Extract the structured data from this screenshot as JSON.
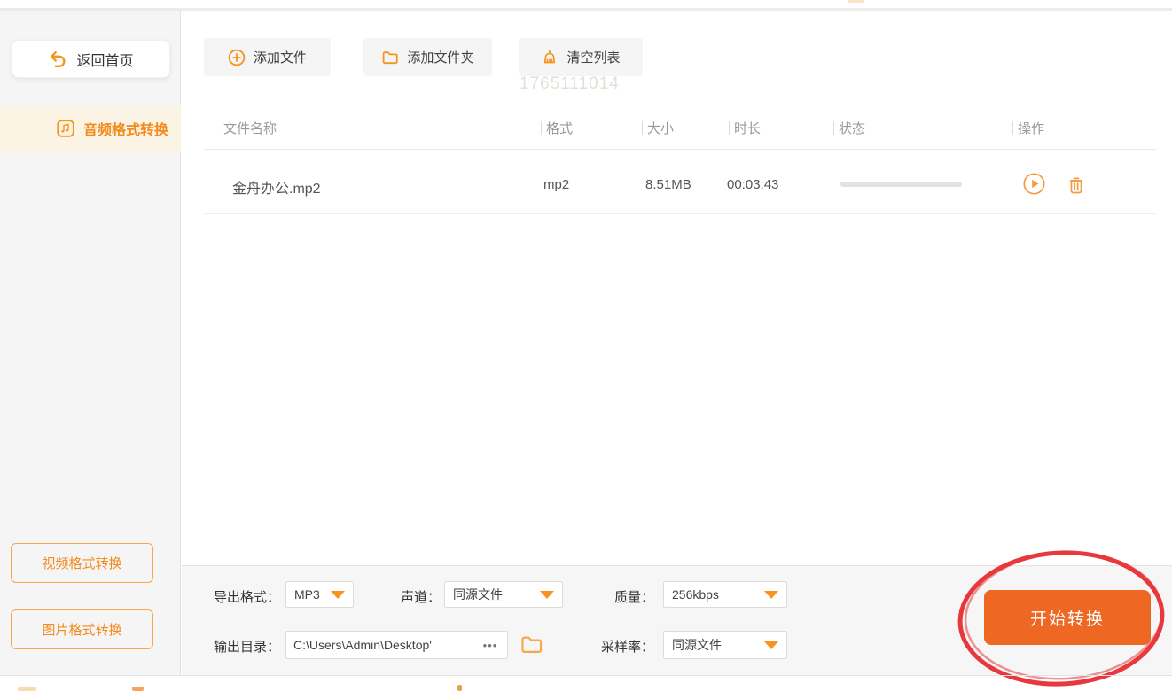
{
  "colors": {
    "accent": "#F7941E",
    "start_button": "#EE6723",
    "annotation_red": "#E8383D",
    "sidebar_bg": "#F5F5F5",
    "active_item_bg": "#FBF4E4"
  },
  "sidebar": {
    "back_label": "返回首页",
    "active_item_label": "音频格式转换",
    "video_button_label": "视频格式转换",
    "image_button_label": "图片格式转换"
  },
  "toolbar": {
    "add_file_label": "添加文件",
    "add_folder_label": "添加文件夹",
    "clear_list_label": "清空列表",
    "watermark": "1765111014"
  },
  "table": {
    "headers": {
      "name": "文件名称",
      "format": "格式",
      "size": "大小",
      "duration": "时长",
      "status": "状态",
      "actions": "操作"
    },
    "row": {
      "name": "金舟办公.mp2",
      "format": "mp2",
      "size": "8.51MB",
      "duration": "00:03:43",
      "status_progress_percent": 0
    }
  },
  "settings": {
    "export_format_label": "导出格式：",
    "export_format_value": "MP3",
    "channel_label": "声道：",
    "channel_value": "同源文件",
    "quality_label": "质量：",
    "quality_value": "256kbps",
    "output_dir_label": "输出目录：",
    "output_dir_value": "C:\\Users\\Admin\\Desktop'",
    "output_dir_more": "•••",
    "sample_rate_label": "采样率：",
    "sample_rate_value": "同源文件"
  },
  "start_button_label": "开始转换"
}
